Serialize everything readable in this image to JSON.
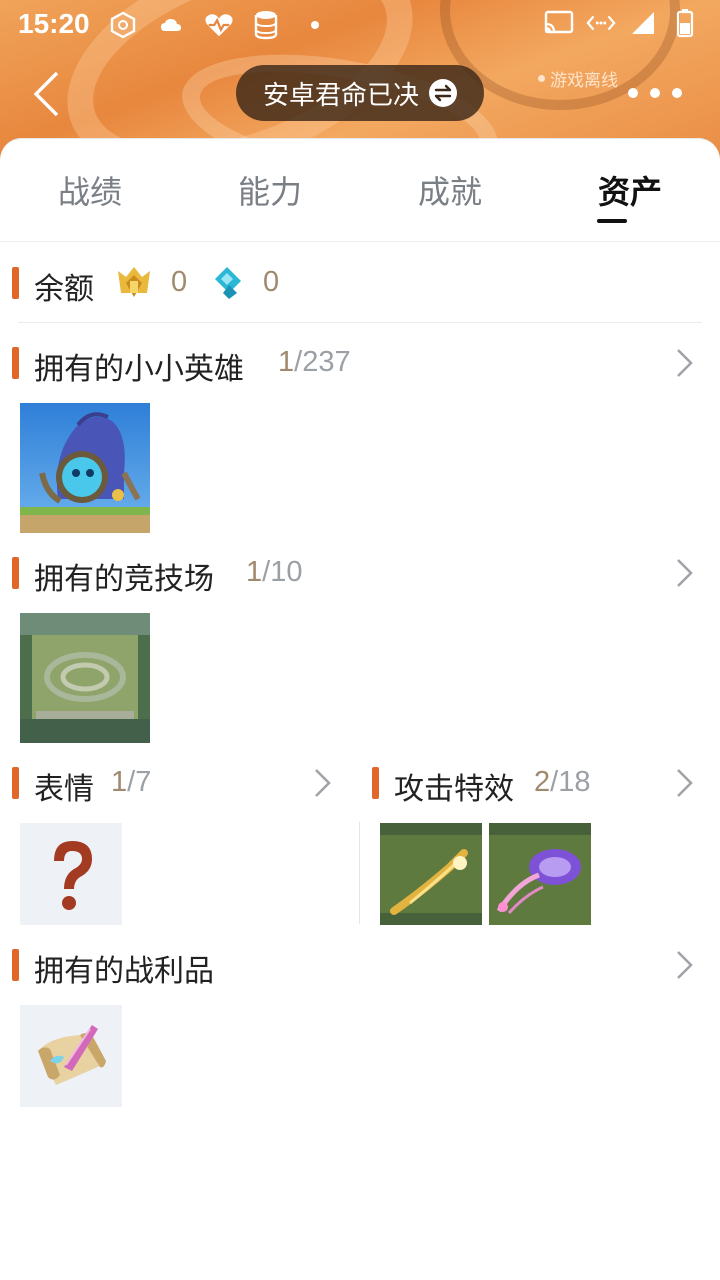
{
  "status_bar": {
    "time": "15:20",
    "left_icons": [
      "chip-icon",
      "cloud-icon",
      "heartbeat-icon",
      "database-icon",
      "dot-icon"
    ],
    "right_icons": [
      "cast-icon",
      "data-arrows-icon",
      "signal-icon",
      "battery-icon"
    ]
  },
  "header": {
    "account_name": "安卓君命已决",
    "offline_label": "游戏离线"
  },
  "tabs": [
    {
      "label": "战绩",
      "active": false
    },
    {
      "label": "能力",
      "active": false
    },
    {
      "label": "成就",
      "active": false
    },
    {
      "label": "资产",
      "active": true
    }
  ],
  "balance": {
    "title": "余额",
    "coin_a": "0",
    "coin_b": "0"
  },
  "sections": {
    "little_legends": {
      "title": "拥有的小小英雄",
      "owned": "1",
      "total": "/237"
    },
    "arenas": {
      "title": "拥有的竞技场",
      "owned": "1",
      "total": "/10"
    },
    "emotes": {
      "title": "表情",
      "owned": "1",
      "total": "/7"
    },
    "attack_effects": {
      "title": "攻击特效",
      "owned": "2",
      "total": "/18"
    },
    "loot": {
      "title": "拥有的战利品"
    }
  },
  "colors": {
    "accent": "#e0662a",
    "count": "#a08a6e",
    "header_orange": "#e8873e"
  }
}
